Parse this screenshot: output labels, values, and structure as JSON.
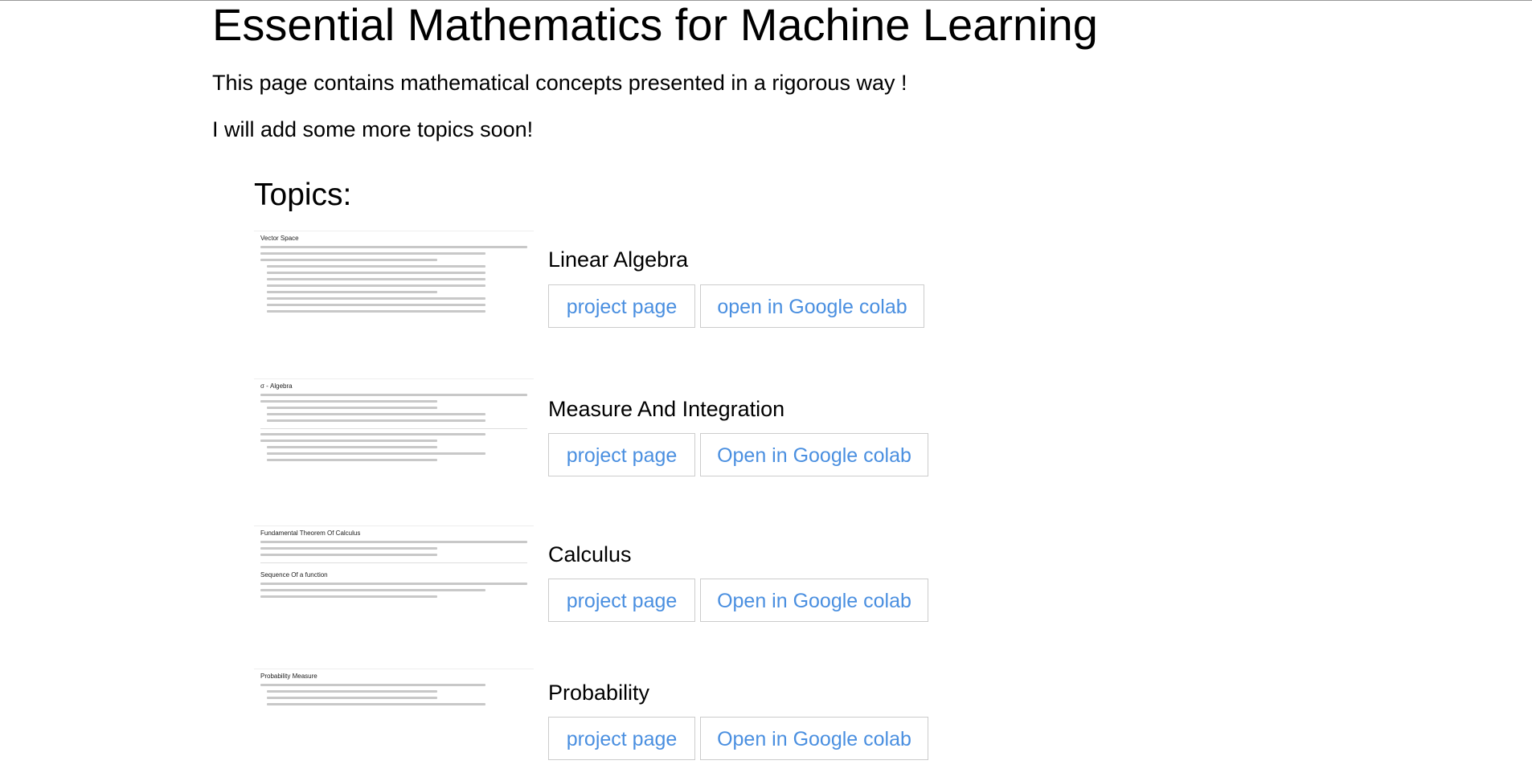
{
  "page": {
    "title": "Essential Mathematics for Machine Learning",
    "intro_1": "This page contains mathematical concepts presented in a rigorous way !",
    "intro_2": "I will add some more topics soon!",
    "topics_heading": "Topics:"
  },
  "topics": [
    {
      "name": "Linear Algebra",
      "project_label": "project page",
      "colab_label": "open in Google colab",
      "thumbnail_title": "Vector Space"
    },
    {
      "name": "Measure And Integration",
      "project_label": "project page",
      "colab_label": "Open in Google colab",
      "thumbnail_title": "σ - Algebra"
    },
    {
      "name": "Calculus",
      "project_label": "project page",
      "colab_label": "Open in Google colab",
      "thumbnail_title": "Fundamental Theorem Of Calculus",
      "thumbnail_title_2": "Sequence Of a function"
    },
    {
      "name": "Probability",
      "project_label": "project page",
      "colab_label": "Open in Google colab",
      "thumbnail_title": "Probability Measure"
    }
  ],
  "colors": {
    "link": "#4a8fe0",
    "button_border": "#cccccc"
  }
}
